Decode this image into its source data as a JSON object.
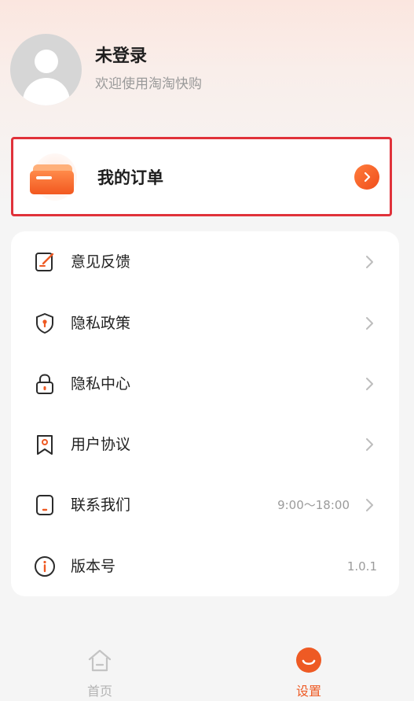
{
  "profile": {
    "name": "未登录",
    "subtitle": "欢迎使用淘淘快购"
  },
  "orders": {
    "label": "我的订单",
    "icon": "folder-icon",
    "accent": "#f2581f"
  },
  "menu": [
    {
      "label": "意见反馈",
      "icon": "feedback-icon",
      "value": ""
    },
    {
      "label": "隐私政策",
      "icon": "shield-icon",
      "value": ""
    },
    {
      "label": "隐私中心",
      "icon": "lock-icon",
      "value": ""
    },
    {
      "label": "用户协议",
      "icon": "bookmark-icon",
      "value": ""
    },
    {
      "label": "联系我们",
      "icon": "phone-icon",
      "value": "9:00～18:00"
    },
    {
      "label": "版本号",
      "icon": "info-icon",
      "value": "1.0.1"
    }
  ],
  "tabs": {
    "home": {
      "label": "首页",
      "active": false
    },
    "settings": {
      "label": "设置",
      "active": true
    }
  },
  "colors": {
    "accent": "#ee5a24",
    "highlight_border": "#e0323a",
    "inactive": "#b3b3b3"
  }
}
